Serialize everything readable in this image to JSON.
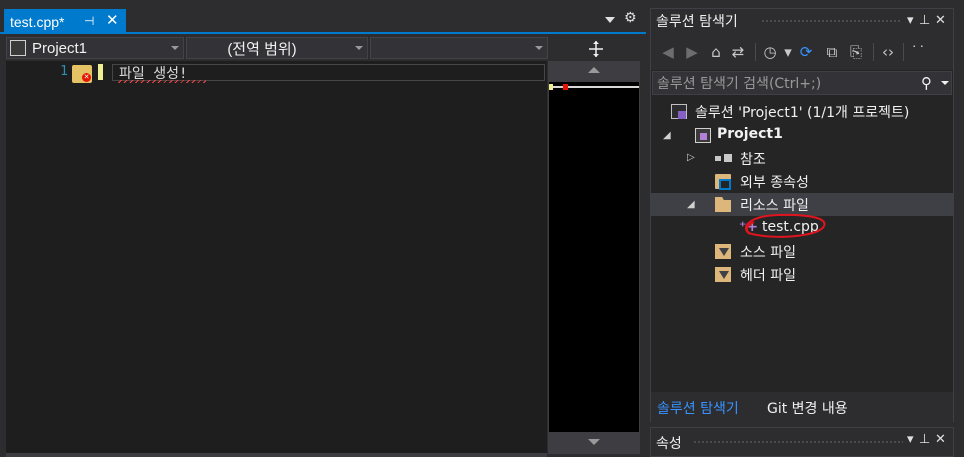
{
  "editor": {
    "tab": {
      "title": "test.cpp*",
      "pin_glyph": "⊣",
      "close_glyph": "✕"
    },
    "navbar": {
      "project": "Project1",
      "scope": "(전역 범위)",
      "member": ""
    },
    "code": {
      "line_number": "1",
      "line_text": "파일 생성!"
    }
  },
  "solution_explorer": {
    "title": "솔루션 탐색기",
    "search_placeholder": "솔루션 탐색기 검색(Ctrl+;)",
    "tree": [
      {
        "label": "솔루션 'Project1' (1/1개 프로젝트)",
        "icon": "solution-icon"
      },
      {
        "label": "Project1",
        "icon": "project-icon",
        "expanded": true
      },
      {
        "label": "참조",
        "icon": "references-icon",
        "expanded": false
      },
      {
        "label": "외부 종속성",
        "icon": "external-deps-icon"
      },
      {
        "label": "리소스 파일",
        "icon": "folder-open-icon",
        "expanded": true,
        "selected": true
      },
      {
        "label": "test.cpp",
        "icon": "cpp-file-icon"
      },
      {
        "label": "소스 파일",
        "icon": "filter-folder-icon"
      },
      {
        "label": "헤더 파일",
        "icon": "filter-folder-icon"
      }
    ],
    "bottom_tabs": [
      {
        "label": "솔루션 탐색기",
        "active": true
      },
      {
        "label": "Git 변경 내용",
        "active": false
      }
    ],
    "accent_color": "#3794ff"
  },
  "properties": {
    "title": "속성"
  },
  "colors": {
    "tab_active": "#007acc",
    "line_number": "#2b91af",
    "error": "#e51400",
    "annotation": "#e0141e"
  }
}
